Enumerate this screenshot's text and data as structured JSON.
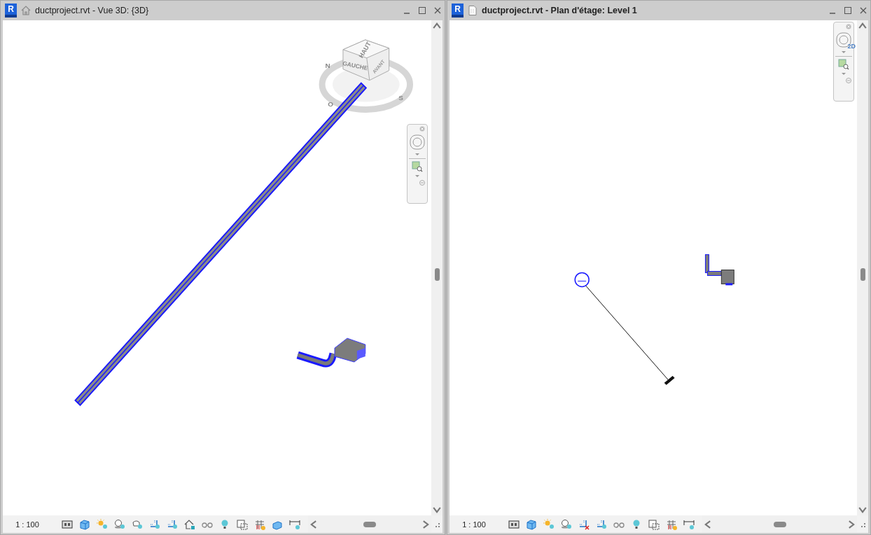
{
  "windows": [
    {
      "kind": "perspective",
      "logo": "R",
      "title": "ductproject.rvt - Vue 3D: {3D}",
      "active": false,
      "view_cube": {
        "top": "HAUT",
        "left": "GAUCHE",
        "front": "AVANT",
        "compass": [
          "N",
          "O",
          "S"
        ]
      },
      "scale": "1 : 100"
    },
    {
      "kind": "plan",
      "logo": "R",
      "title": "ductproject.rvt - Plan d'étage: Level 1",
      "active": true,
      "nav_badge": "2D",
      "scale": "1 : 100"
    }
  ]
}
